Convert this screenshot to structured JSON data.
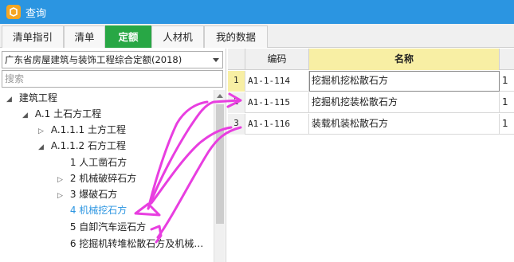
{
  "window": {
    "title": "查询",
    "icon": "app-logo-icon"
  },
  "tabs": [
    {
      "label": "清单指引",
      "active": false
    },
    {
      "label": "清单",
      "active": false
    },
    {
      "label": "定额",
      "active": true
    },
    {
      "label": "人材机",
      "active": false
    },
    {
      "label": "我的数据",
      "active": false
    }
  ],
  "left": {
    "quota_select": "广东省房屋建筑与装饰工程综合定额(2018)",
    "search_placeholder": "搜索",
    "tree": [
      {
        "expander": "◢",
        "label": "建筑工程"
      },
      {
        "expander": "◢",
        "label": "A.1 土石方工程"
      },
      {
        "expander": "▷",
        "label": "A.1.1.1 土方工程"
      },
      {
        "expander": "◢",
        "label": "A.1.1.2 石方工程"
      },
      {
        "expander": "",
        "label": "1 人工凿石方"
      },
      {
        "expander": "▷",
        "label": "2 机械破碎石方"
      },
      {
        "expander": "▷",
        "label": "3 爆破石方"
      },
      {
        "expander": "",
        "label": "4 机械挖石方",
        "selected": true
      },
      {
        "expander": "",
        "label": "5 自卸汽车运石方"
      },
      {
        "expander": "",
        "label": "6 挖掘机转堆松散石方及机械…"
      }
    ]
  },
  "grid": {
    "headers": {
      "index": "",
      "code": "编码",
      "name": "名称",
      "extra": ""
    },
    "rows": [
      {
        "index": "1",
        "code": "A1-1-114",
        "name": "挖掘机挖松散石方",
        "extra": "1",
        "selected": true
      },
      {
        "index": "2",
        "code": "A1-1-115",
        "name": "挖掘机挖装松散石方",
        "extra": "1"
      },
      {
        "index": "3",
        "code": "A1-1-116",
        "name": "装载机装松散石方",
        "extra": "1"
      }
    ]
  },
  "colors": {
    "titlebar": "#2b95e1",
    "active_tab": "#28a745",
    "header_highlight": "#f8efa4",
    "annotation": "#e83ee0"
  }
}
